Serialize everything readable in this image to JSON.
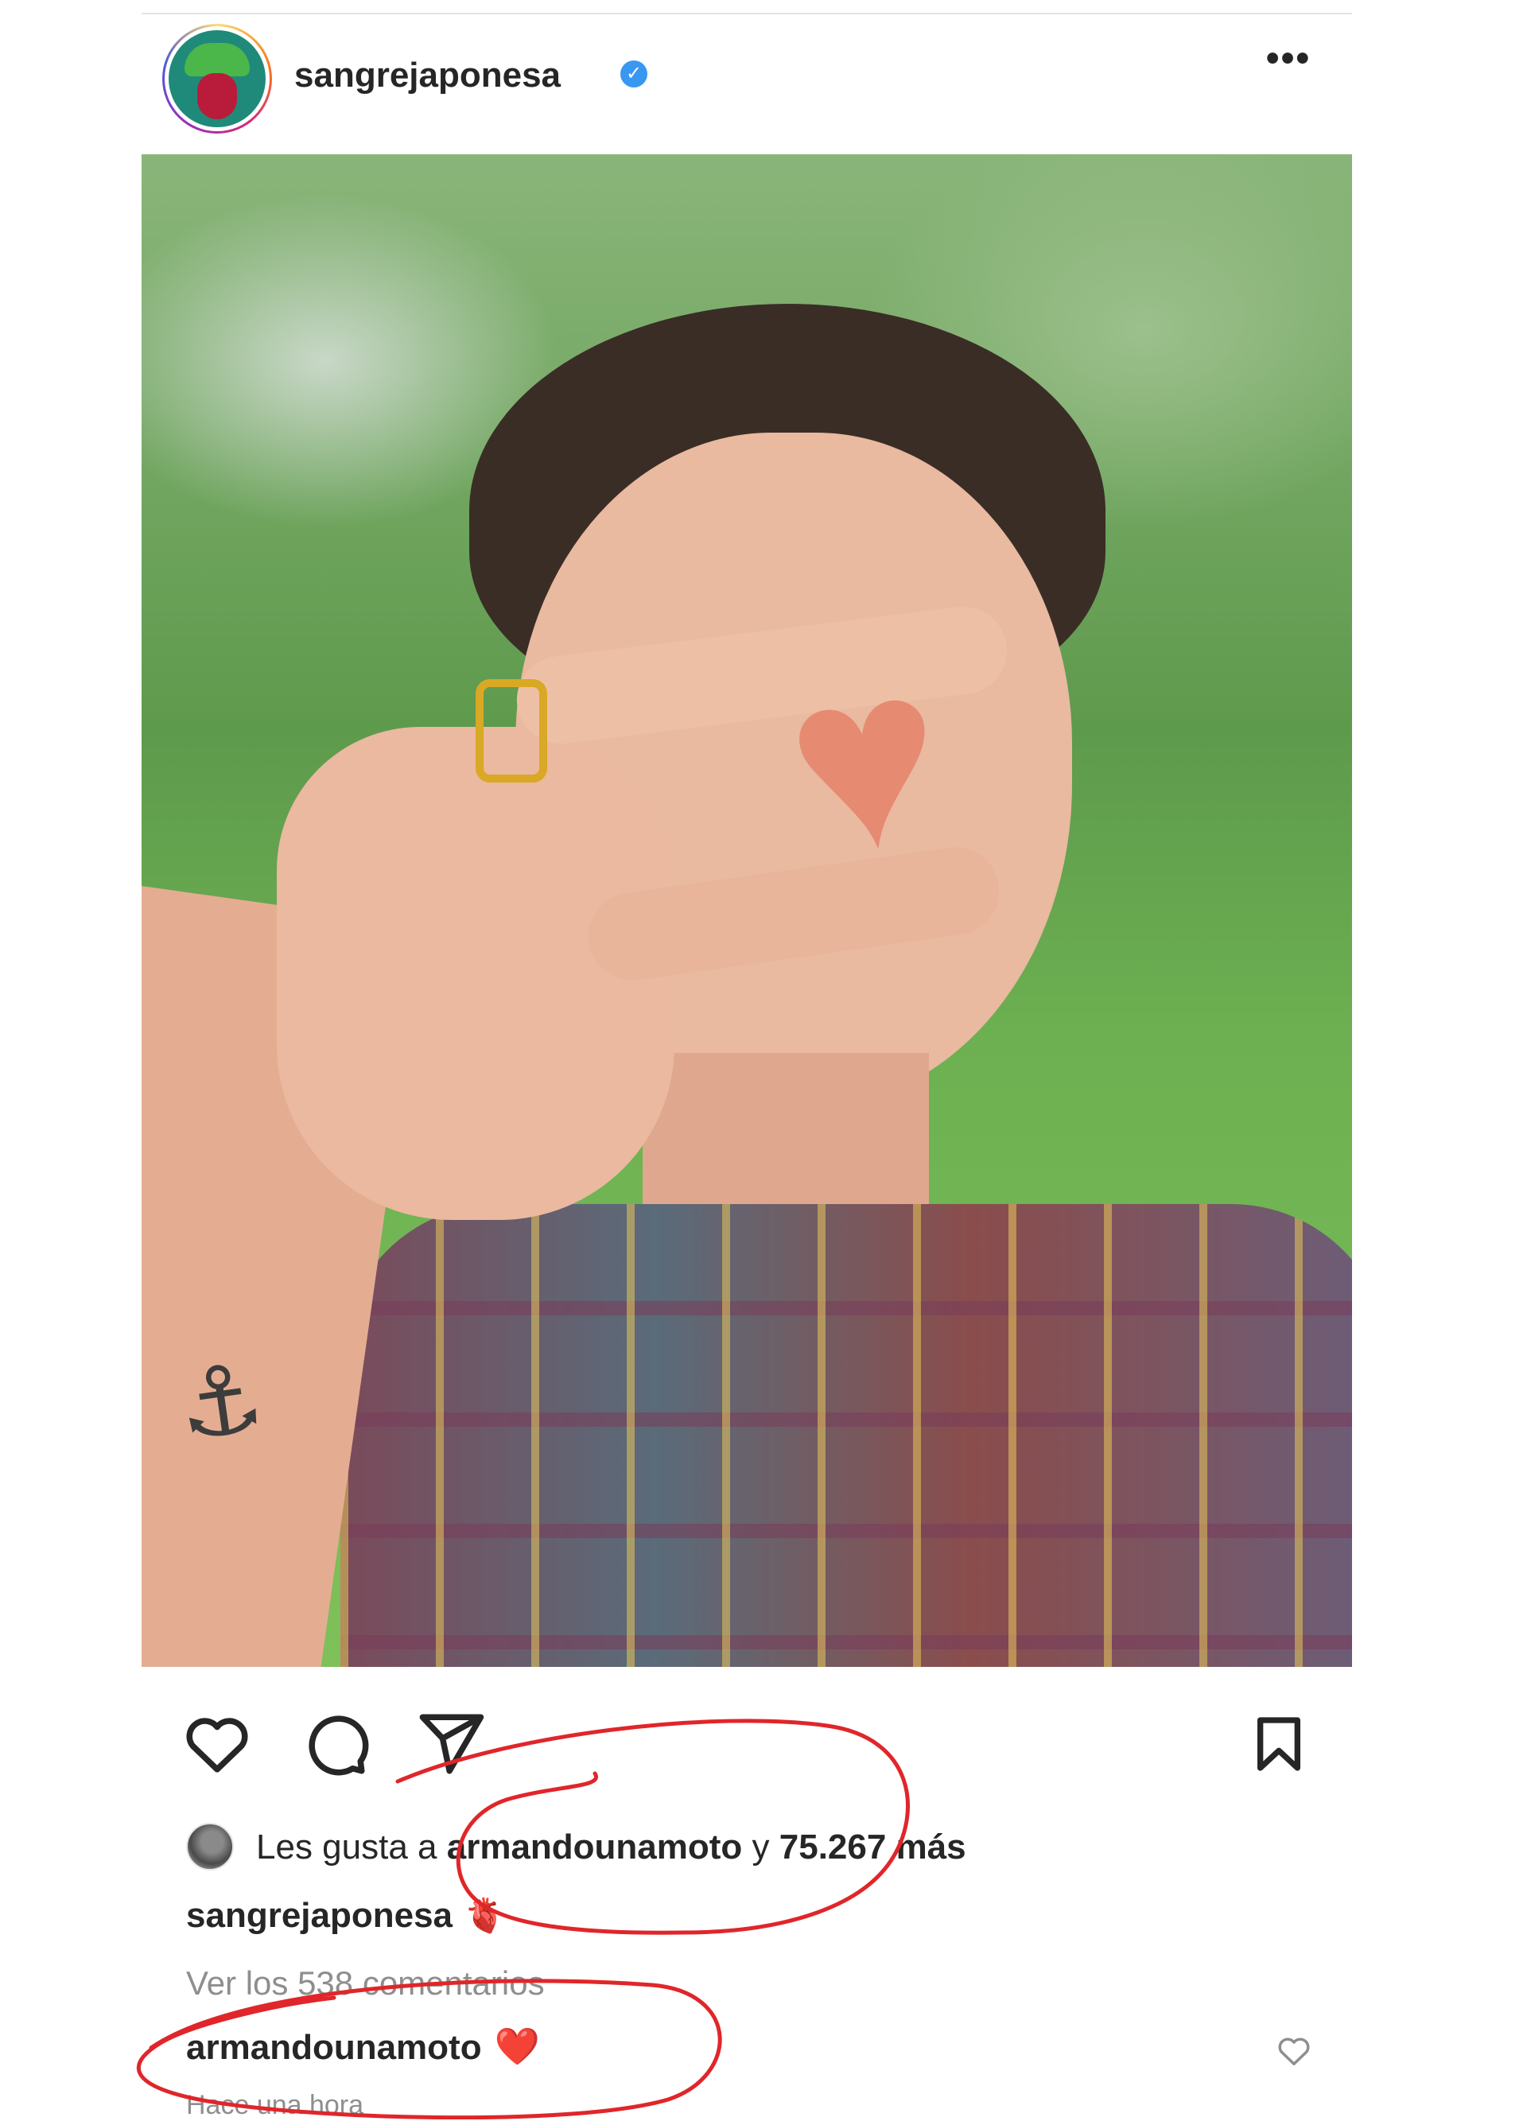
{
  "post": {
    "username": "sangrejaponesa",
    "verified_badge": "✓",
    "more_icon": "•••",
    "photo_alt": "Mujer sosteniendo un trozo en forma de corazón frente a su ojo",
    "likes": {
      "prefix": "Les gusta a ",
      "liker": "armandounamoto",
      "middle": " y ",
      "count": "75.267 más"
    },
    "caption": {
      "user": "sangrejaponesa",
      "emoji": "🫀"
    },
    "view_comments": "Ver los 538 comentarios",
    "comment": {
      "user": "armandounamoto",
      "emoji": "❤️"
    },
    "timestamp": "Hace una hora"
  },
  "icons": {
    "like": "heart-icon",
    "comment": "comment-bubble-icon",
    "share": "paper-plane-icon",
    "save": "bookmark-icon",
    "comment_like": "heart-outline-icon"
  },
  "colors": {
    "text": "#262626",
    "secondary_text": "#8e8e8e",
    "verified": "#3897f0",
    "annotation_red": "#e0262a"
  }
}
